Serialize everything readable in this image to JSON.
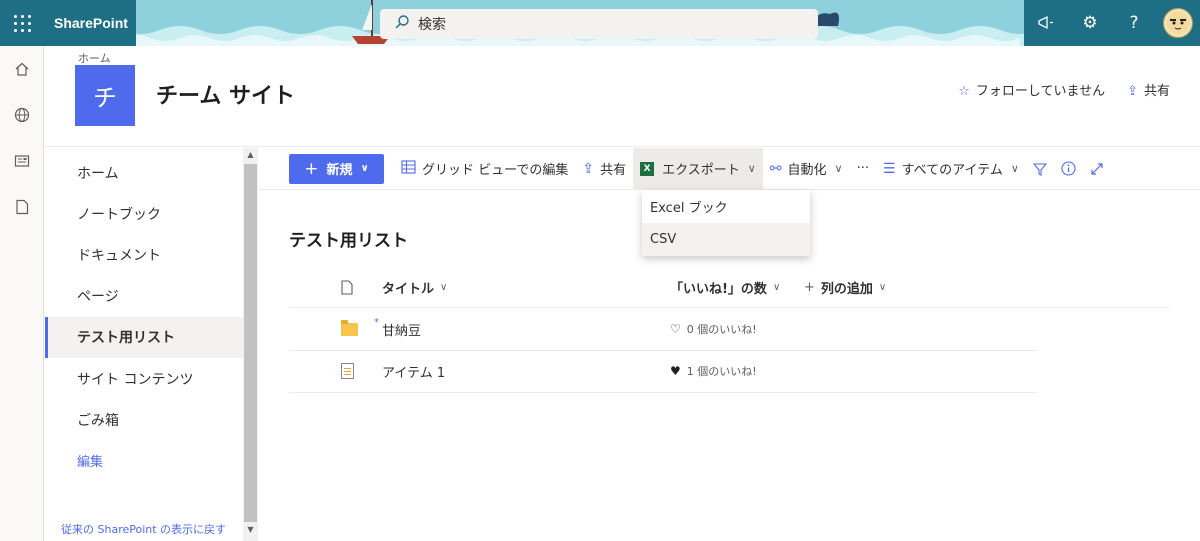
{
  "suite": {
    "app_name": "SharePoint",
    "search_placeholder": "検索"
  },
  "leftrail": {
    "icons": [
      "home-icon",
      "globe-icon",
      "news-icon",
      "document-icon"
    ]
  },
  "header": {
    "breadcrumb": "ホーム",
    "logo_letter": "チ",
    "site_title": "チーム サイト",
    "follow_label": "フォローしていません",
    "share_label": "共有"
  },
  "nav": {
    "items": [
      "ホーム",
      "ノートブック",
      "ドキュメント",
      "ページ",
      "テスト用リスト",
      "サイト コンテンツ",
      "ごみ箱"
    ],
    "selected": "テスト用リスト",
    "edit_label": "編集",
    "classic_link": "従来の SharePoint の表示に戻す"
  },
  "commandbar": {
    "new_label": "新規",
    "grid_edit_label": "グリッド ビューでの編集",
    "share_label": "共有",
    "export_label": "エクスポート",
    "automate_label": "自動化",
    "more_label": "···",
    "view_label": "すべてのアイテム"
  },
  "export_menu": {
    "items": [
      "Excel ブック",
      "CSV"
    ],
    "highlighted": "CSV"
  },
  "list": {
    "title": "テスト用リスト",
    "columns": {
      "title": "タイトル",
      "likes": "「いいね!」の数",
      "add_column": "列の追加"
    },
    "rows": [
      {
        "title": "甘納豆",
        "type": "folder",
        "likes": "0 個のいいね!",
        "liked": false
      },
      {
        "title": "アイテム 1",
        "type": "item",
        "likes": "1 個のいいね!",
        "liked": true
      }
    ]
  },
  "colors": {
    "accent": "#4f6bed",
    "suitebar": "#1e6e85",
    "excel": "#1d6f42"
  }
}
